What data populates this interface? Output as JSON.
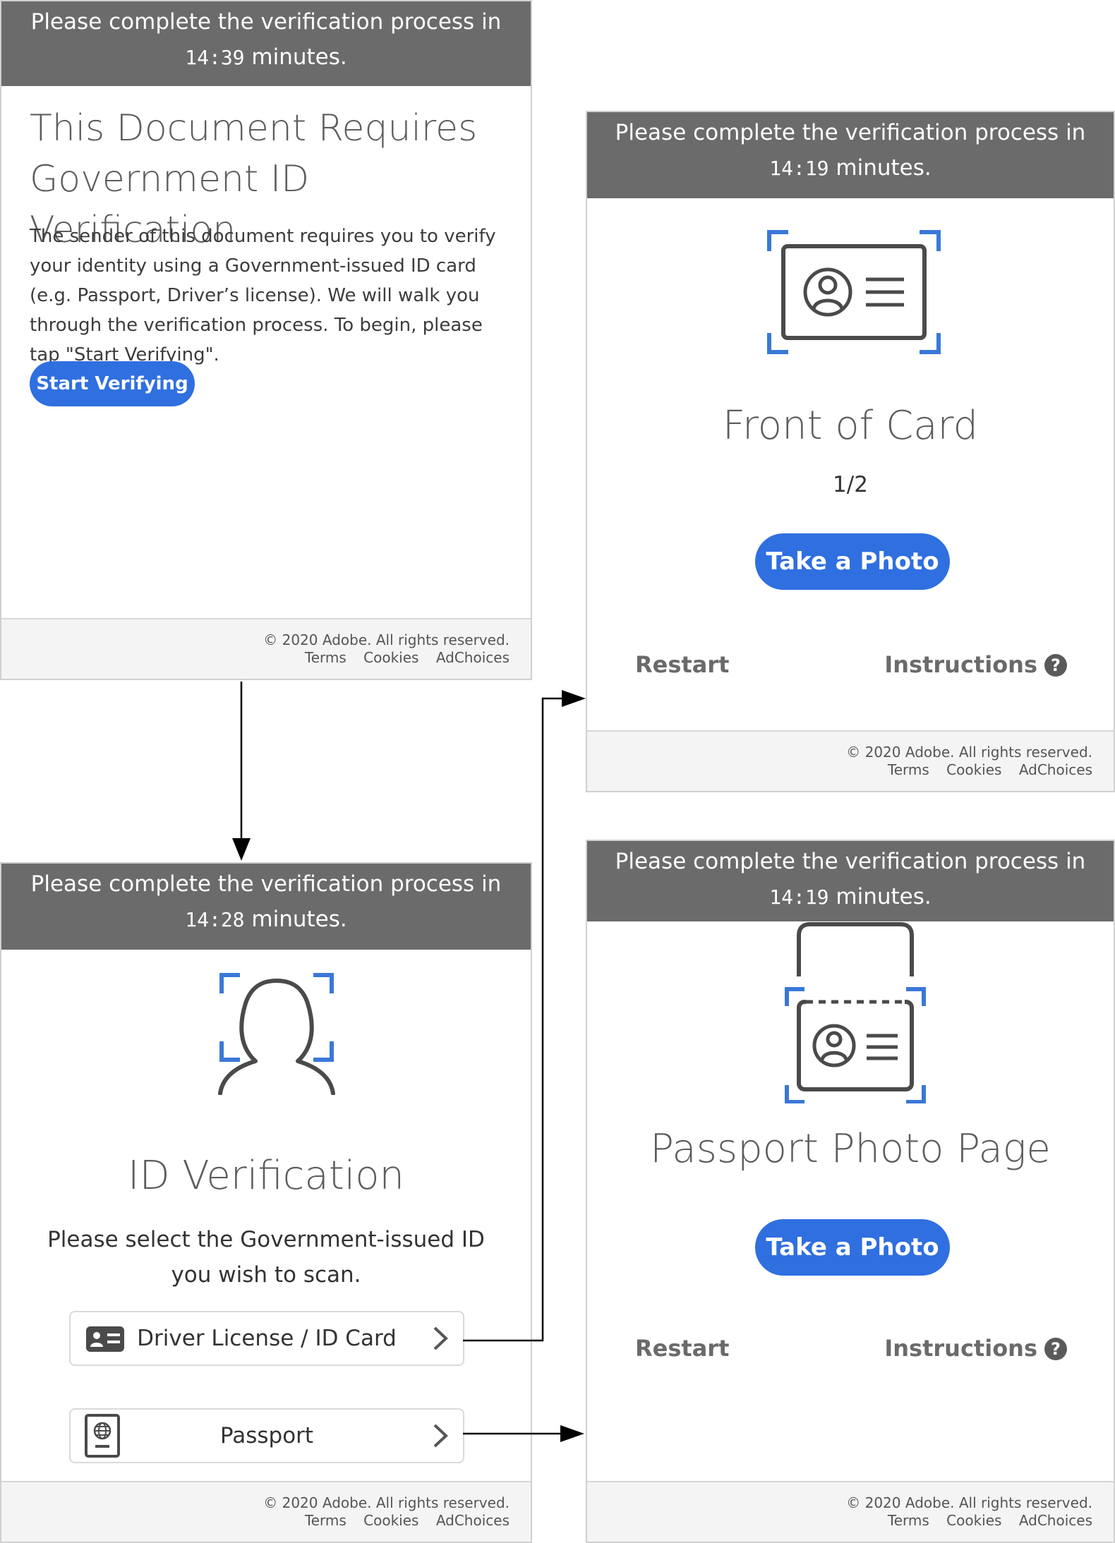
{
  "screens": {
    "intro": {
      "banner_line1": "Please complete the verification process in",
      "banner_time": "14:39",
      "banner_minutes": "minutes.",
      "title_line1": "This Document Requires",
      "title_line2": "Government ID Verification",
      "body": "The sender of this document requires you to verify your identity using a Government-issued ID card (e.g. Passport, Driver’s license). We will walk you through the verification process. To begin, please tap \"Start Verifying\".",
      "start_button": "Start Verifying"
    },
    "select": {
      "banner_line1": "Please complete the verification process in",
      "banner_time": "14:28",
      "banner_minutes": "minutes.",
      "title": "ID Verification",
      "prompt_line1": "Please select the Government-issued ID",
      "prompt_line2": "you wish to scan.",
      "option_driver": "Driver License / ID Card",
      "option_passport": "Passport"
    },
    "front": {
      "banner_line1": "Please complete the verification process in",
      "banner_time": "14:19",
      "banner_minutes": "minutes.",
      "title": "Front of Card",
      "step": "1/2",
      "photo_button": "Take a Photo",
      "restart": "Restart",
      "instructions": "Instructions"
    },
    "passport": {
      "banner_line1": "Please complete the verification process in",
      "banner_time": "14:19",
      "banner_minutes": "minutes.",
      "title": "Passport Photo Page",
      "photo_button": "Take a Photo",
      "restart": "Restart",
      "instructions": "Instructions"
    }
  },
  "footer": {
    "copyright": "© 2020 Adobe. All rights reserved.",
    "terms": "Terms",
    "cookies": "Cookies",
    "adchoices": "AdChoices"
  },
  "icons": {
    "help": "?",
    "flow_arrows": "arrow-icon"
  },
  "colors": {
    "accent": "#2f6fe0",
    "banner": "#6b6b6b",
    "scan_frame": "#3a78d8"
  }
}
